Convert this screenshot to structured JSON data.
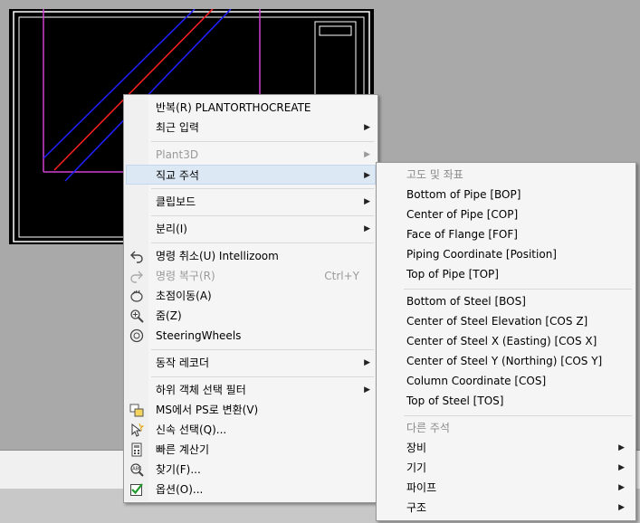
{
  "context_menu": {
    "items": [
      {
        "label": "반복(R) PLANTORTHOCREATE"
      },
      {
        "label": "최근 입력"
      },
      {
        "label": "Plant3D"
      },
      {
        "label": "직교 주석"
      },
      {
        "label": "클립보드"
      },
      {
        "label": "분리(I)"
      },
      {
        "label": "명령 취소(U) Intellizoom"
      },
      {
        "label": "명령 복구(R)",
        "shortcut": "Ctrl+Y"
      },
      {
        "label": "초점이동(A)"
      },
      {
        "label": "줌(Z)"
      },
      {
        "label": "SteeringWheels"
      },
      {
        "label": "동작 레코더"
      },
      {
        "label": "하위 객체 선택 필터"
      },
      {
        "label": "MS에서 PS로 변환(V)"
      },
      {
        "label": "신속 선택(Q)..."
      },
      {
        "label": "빠른 계산기"
      },
      {
        "label": "찾기(F)..."
      },
      {
        "label": "옵션(O)..."
      }
    ]
  },
  "submenu": {
    "header_elevation": "고도 및 좌표",
    "elevation_items": [
      "Bottom of Pipe [BOP]",
      "Center of Pipe [COP]",
      "Face of Flange [FOF]",
      "Piping Coordinate [Position]",
      "Top of Pipe [TOP]"
    ],
    "steel_items": [
      "Bottom of Steel [BOS]",
      "Center of Steel Elevation [COS Z]",
      "Center of Steel X (Easting) [COS X]",
      "Center of Steel Y (Northing) [COS Y]",
      "Column Coordinate [COS]",
      "Top of Steel [TOS]"
    ],
    "header_other": "다른 주석",
    "other_items": [
      "장비",
      "기기",
      "파이프",
      "구조"
    ]
  },
  "colors": {
    "menu_bg": "#f5f5f5",
    "highlight": "#dde8f5",
    "disabled": "#9a9a9a",
    "cad_bg": "#000000"
  }
}
